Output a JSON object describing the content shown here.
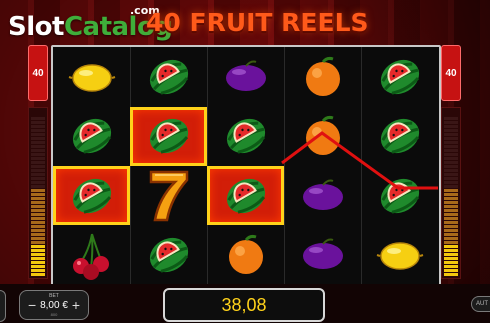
{
  "logo": {
    "slot": "Slot",
    "catalog": "Catalog",
    "com": ".com"
  },
  "title": "40 FRUIT REELS",
  "lines_left": "40",
  "lines_right": "40",
  "reels": [
    [
      "lemon",
      "watermelon",
      "cherries"
    ],
    [
      "watermelon",
      "watermelon",
      "seven",
      "watermelon"
    ],
    [
      "plum",
      "watermelon",
      "watermelon",
      "orange"
    ],
    [
      "orange",
      "orange",
      "plum",
      "plum"
    ],
    [
      "watermelon",
      "watermelon",
      "watermelon",
      "lemon"
    ]
  ],
  "grid": [
    [
      "lemon",
      "watermelon",
      "plum",
      "orange",
      "watermelon"
    ],
    [
      "watermelon",
      "watermelon",
      "watermelon",
      "orange",
      "watermelon"
    ],
    [
      "watermelon",
      "seven",
      "watermelon",
      "plum",
      "watermelon"
    ],
    [
      "cherries",
      "watermelon",
      "orange",
      "plum",
      "lemon"
    ]
  ],
  "winning_cells": [
    [
      1,
      1
    ],
    [
      2,
      0
    ],
    [
      2,
      2
    ]
  ],
  "bet": {
    "label": "BET",
    "value": "8,00 €",
    "sub": "800",
    "minus": "−",
    "plus": "+"
  },
  "win": "38,08",
  "auto_label": "AUT",
  "colors": {
    "accent": "#ffd21a",
    "win_cell": "#d21e08",
    "payline": "#e01010"
  }
}
